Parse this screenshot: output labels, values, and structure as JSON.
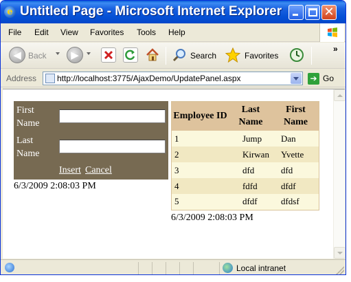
{
  "window": {
    "title": "Untitled Page - Microsoft Internet Explorer"
  },
  "menu": {
    "items": [
      "File",
      "Edit",
      "View",
      "Favorites",
      "Tools",
      "Help"
    ]
  },
  "toolbar": {
    "back_label": "Back",
    "search_label": "Search",
    "favorites_label": "Favorites",
    "overflow": "»"
  },
  "address": {
    "label": "Address",
    "url": "http://localhost:3775/AjaxDemo/UpdatePanel.aspx",
    "go_label": "Go"
  },
  "form": {
    "first_name_label": "First Name",
    "last_name_label": "Last Name",
    "first_name_value": "",
    "last_name_value": "",
    "insert_label": "Insert",
    "cancel_label": "Cancel",
    "timestamp": "6/3/2009 2:08:03 PM"
  },
  "grid": {
    "headers": [
      "Employee ID",
      "Last Name",
      "First Name"
    ],
    "rows": [
      [
        "1",
        "Jump",
        "Dan"
      ],
      [
        "2",
        "Kirwan",
        "Yvette"
      ],
      [
        "3",
        "dfd",
        "dfd"
      ],
      [
        "4",
        "fdfd",
        "dfdf"
      ],
      [
        "5",
        "dfdf",
        "dfdsf"
      ]
    ],
    "timestamp": "6/3/2009 2:08:03 PM"
  },
  "status": {
    "zone": "Local intranet"
  },
  "colors": {
    "titlebar": "#0551d6",
    "form_panel": "#776a52",
    "grid_header": "#dec39d",
    "grid_row_odd": "#fbf8dd",
    "grid_row_even": "#f1e8c2"
  }
}
